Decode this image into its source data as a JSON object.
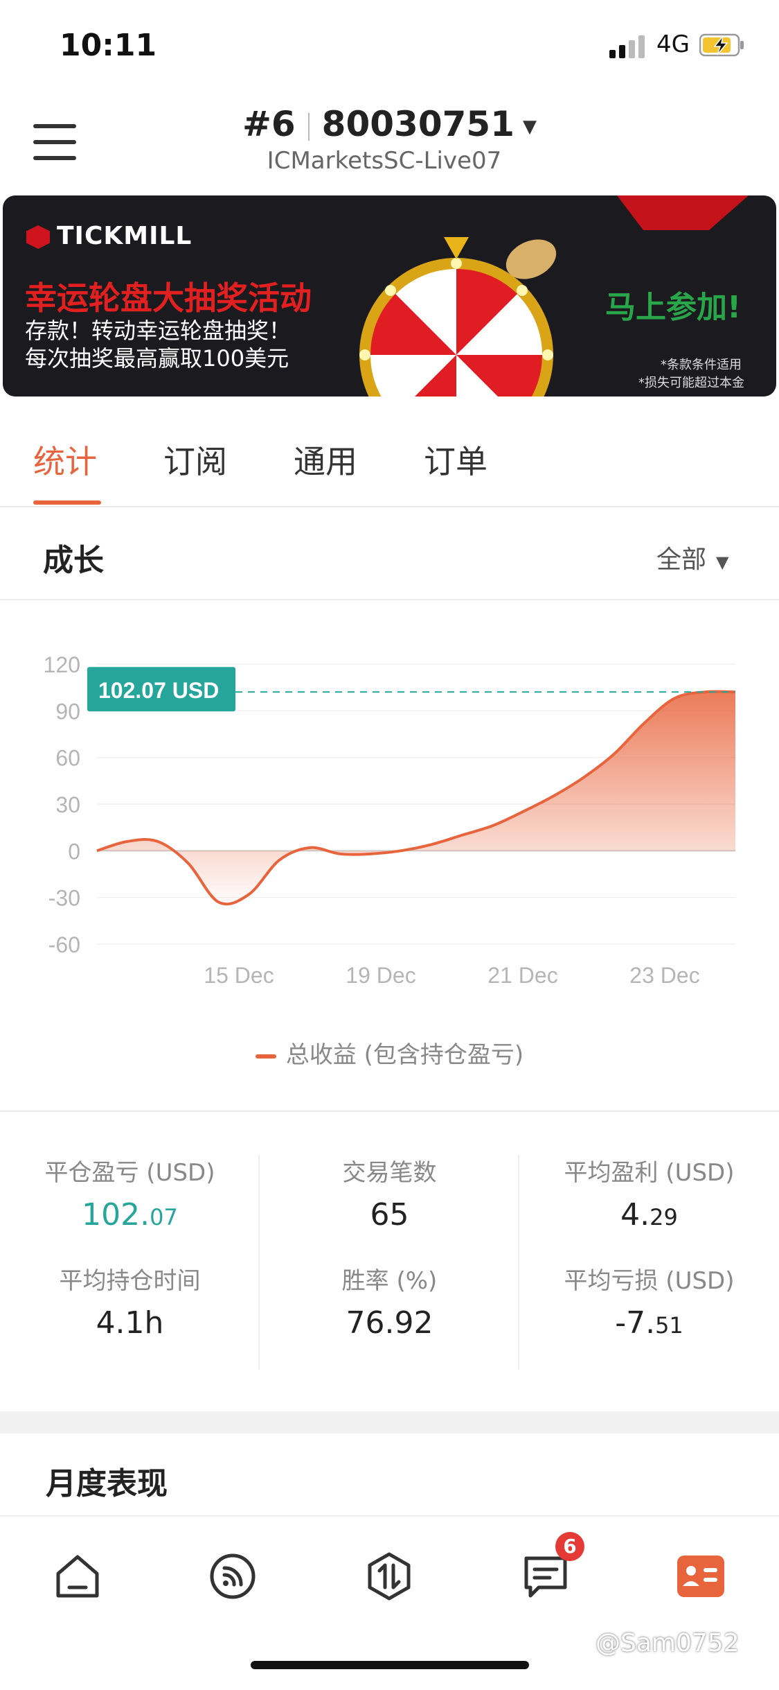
{
  "status_bar": {
    "time": "10:11",
    "network": "4G"
  },
  "header": {
    "account_index": "#6",
    "account_number": "80030751",
    "server": "ICMarketsSC-Live07"
  },
  "banner": {
    "brand": "TICKMILL",
    "title": "幸运轮盘大抽奖活动",
    "line1": "存款！转动幸运轮盘抽奖！",
    "line2": "每次抽奖最高赢取100美元",
    "cta": "马上参加!",
    "note1": "*条款条件适用",
    "note2": "*损失可能超过本金"
  },
  "tabs": [
    {
      "label": "统计"
    },
    {
      "label": "订阅"
    },
    {
      "label": "通用"
    },
    {
      "label": "订单"
    }
  ],
  "growth": {
    "title": "成长",
    "filter": "全部"
  },
  "colors": {
    "accent": "#e8643c",
    "profit": "#26a69a"
  },
  "chart_data": {
    "type": "area",
    "ylim": [
      -60,
      120
    ],
    "yticks": [
      "120",
      "90",
      "60",
      "30",
      "0",
      "-30",
      "-60"
    ],
    "xtick_labels": [
      "15 Dec",
      "19 Dec",
      "21 Dec",
      "23 Dec"
    ],
    "series": [
      {
        "name": "总收益 (包含持仓盈亏)",
        "x": [
          0,
          1,
          2,
          3,
          4,
          5,
          6,
          7,
          8,
          9,
          10,
          11,
          12,
          13,
          14,
          15,
          16,
          17,
          18,
          19,
          20,
          21
        ],
        "values": [
          0,
          6,
          6,
          -8,
          -33,
          -28,
          -6,
          2,
          -2,
          -2,
          0,
          4,
          10,
          16,
          25,
          35,
          47,
          62,
          82,
          98,
          102.07,
          102.07
        ]
      }
    ],
    "current_value_label": "102.07 USD",
    "legend": "总收益 (包含持仓盈亏)"
  },
  "stats": [
    {
      "label": "平仓盈亏 (USD)",
      "int": "102.",
      "dec": "07",
      "color": "#26a69a"
    },
    {
      "label": "交易笔数",
      "int": "65",
      "dec": "",
      "color": "#222222"
    },
    {
      "label": "平均盈利 (USD)",
      "int": "4.",
      "dec": "29",
      "color": "#222222"
    },
    {
      "label": "平均持仓时间",
      "int": "4.1h",
      "dec": "",
      "color": "#222222"
    },
    {
      "label": "胜率 (%)",
      "int": "76.92",
      "dec": "",
      "color": "#222222"
    },
    {
      "label": "平均亏损 (USD)",
      "int": "-7.",
      "dec": "51",
      "color": "#222222"
    }
  ],
  "monthly": {
    "title": "月度表现"
  },
  "bottom_nav": {
    "items": [
      {
        "icon": "home-icon"
      },
      {
        "icon": "signal-feed-icon"
      },
      {
        "icon": "trade-icon"
      },
      {
        "icon": "messages-icon"
      },
      {
        "icon": "account-card-icon"
      }
    ],
    "badge_count": "6"
  },
  "watermark": "@Sam0752"
}
